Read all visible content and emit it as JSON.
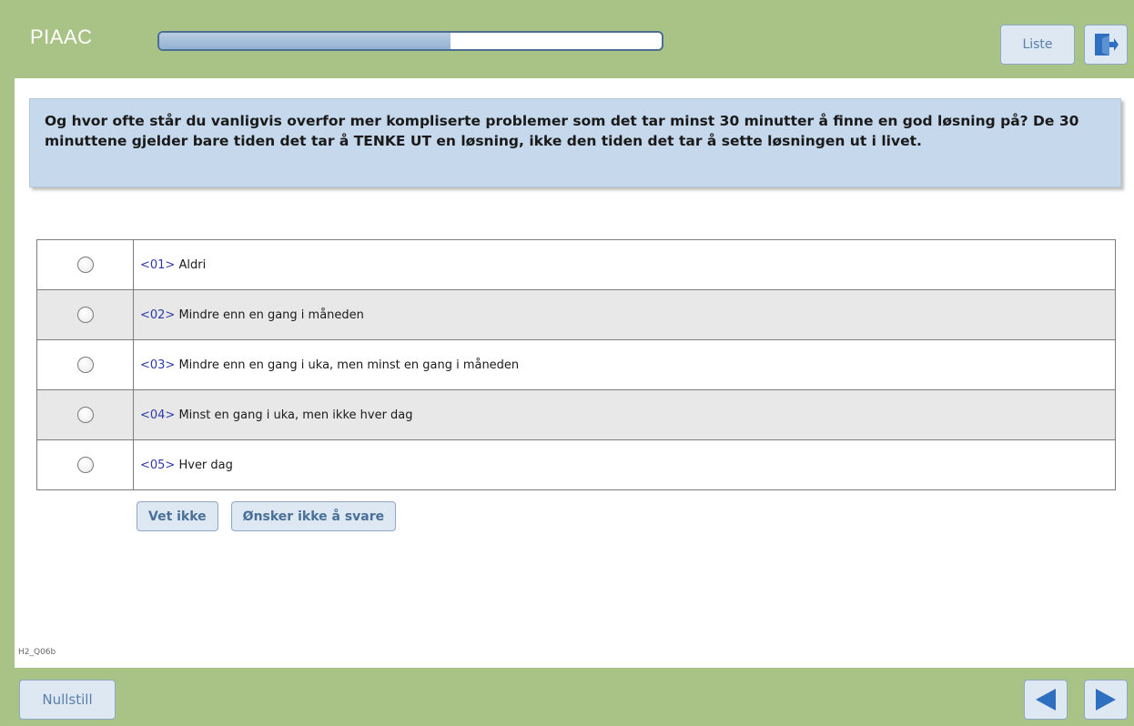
{
  "app": {
    "title": "PIAAC"
  },
  "header": {
    "progress_fraction": 0.58,
    "list_button": "Liste",
    "exit_icon": "exit-door-icon"
  },
  "question": {
    "text": "Og hvor ofte står du vanligvis overfor mer kompliserte problemer som det tar minst 30 minutter å finne en god løsning på? De 30 minuttene gjelder bare tiden det tar å TENKE UT en løsning, ikke den tiden det tar å sette løsningen ut i livet."
  },
  "options": [
    {
      "code": "<01>",
      "label": "Aldri"
    },
    {
      "code": "<02>",
      "label": "Mindre enn en gang i måneden"
    },
    {
      "code": "<03>",
      "label": "Mindre enn en gang i uka, men minst en gang i måneden"
    },
    {
      "code": "<04>",
      "label": "Minst en gang i uka, men ikke hver dag"
    },
    {
      "code": "<05>",
      "label": "Hver dag"
    }
  ],
  "extra_buttons": {
    "dont_know": "Vet ikke",
    "refuse": "Ønsker ikke å svare"
  },
  "item_id": "H2_Q06b",
  "footer": {
    "reset_button": "Nullstill",
    "prev_icon": "arrow-left-icon",
    "next_icon": "arrow-right-icon"
  },
  "colors": {
    "frame": "#a9c285",
    "question_bg": "#c5d8ec",
    "button_bg": "#dde8f3",
    "nav_arrow": "#2f6fc0",
    "code_text": "#2e3aa8"
  }
}
